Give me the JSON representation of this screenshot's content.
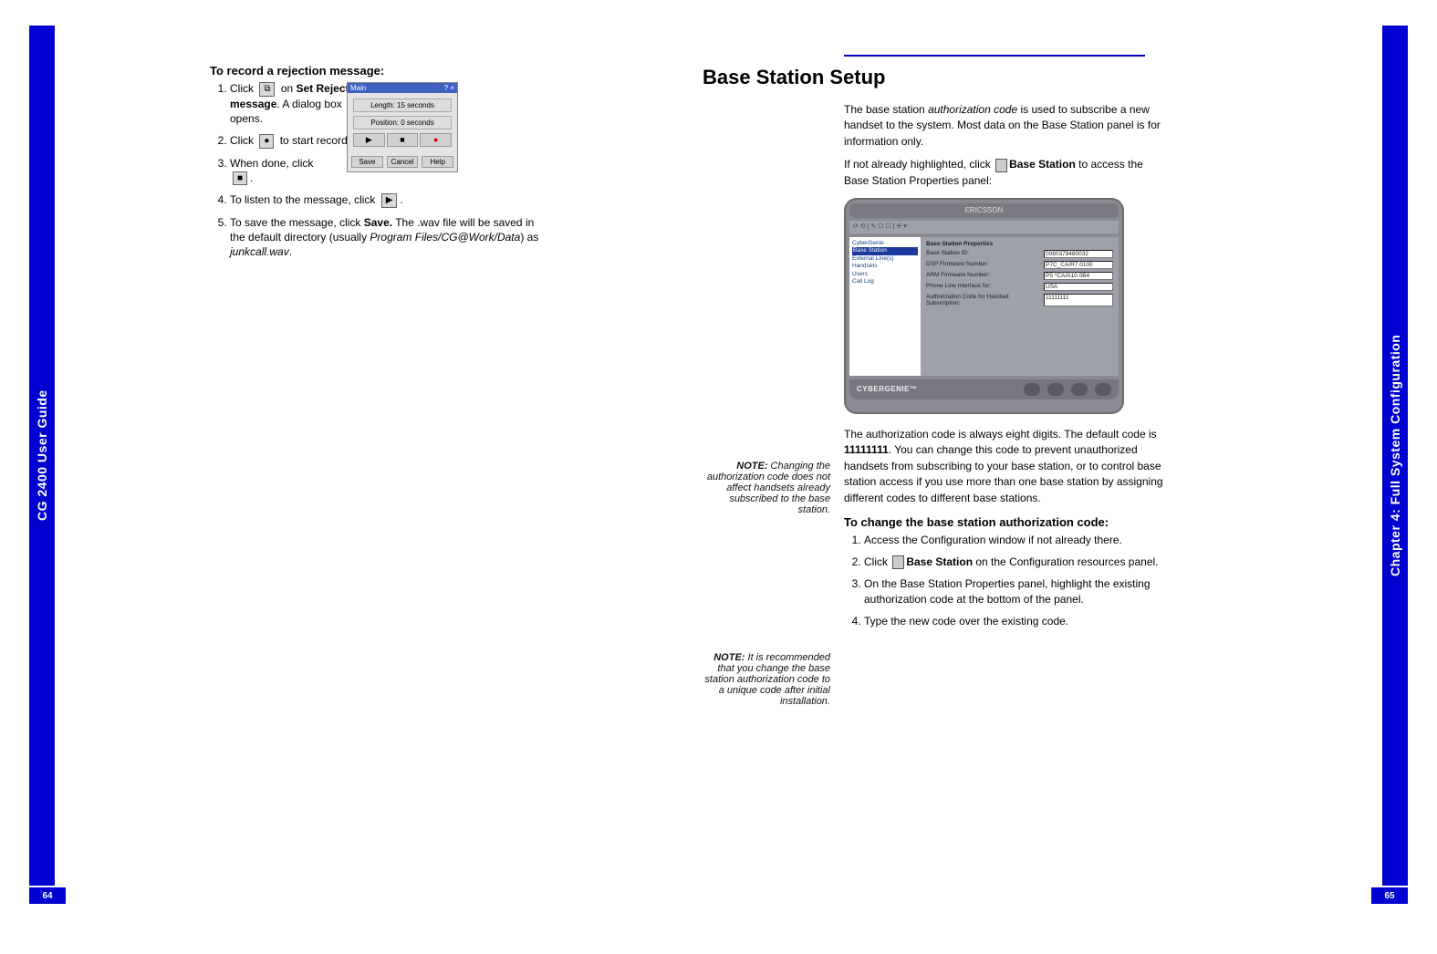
{
  "left_tab": "CG 2400 User Guide",
  "right_tab": "Chapter 4: Full System Configuration",
  "page_left_num": "64",
  "page_right_num": "65",
  "left": {
    "heading": "To record a rejection message:",
    "step1_a": "Click ",
    "step1_b": " on ",
    "step1_bold": "Set Rejection message",
    "step1_c": ". A dialog box opens.",
    "step2_a": "Click ",
    "step2_b": " to start recording.",
    "step3_a": "When done, click ",
    "step3_b": ".",
    "step4_a": "To listen to the message, click ",
    "step4_b": ".",
    "step5_a": "To save the message, click ",
    "step5_bold": "Save.",
    "step5_b": " The .wav file will be saved in the default directory (usually ",
    "step5_ital": "Program Files/CG@Work/Data",
    "step5_c": ") as ",
    "step5_ital2": "junkcall.wav",
    "step5_d": ".",
    "dialog": {
      "title": "Main",
      "len": "Length: 15 seconds",
      "pos": "Position: 0 seconds",
      "btn_play": "▶",
      "btn_stop": "■",
      "btn_rec": "●",
      "f_save": "Save",
      "f_cancel": "Cancel",
      "f_help": "Help"
    }
  },
  "right": {
    "title": "Base Station Setup",
    "p1_a": "The base station ",
    "p1_ital": "authorization code",
    "p1_b": " is used to subscribe a new handset to the system. Most data on the Base Station panel is for information only.",
    "p2_a": "If not already highlighted, click ",
    "p2_bold": "Base Station",
    "p2_b": " to access the Base Station Properties panel:",
    "panel": {
      "header": "ERICSSON",
      "tree": {
        "l1": "CyberGenie",
        "l2_sel": "Base Station",
        "l3": "External Line(s)",
        "l4": "Handsets",
        "l5": "Users",
        "l6": "Call Log"
      },
      "props_title": "Base Station Properties",
      "rows": [
        {
          "label": "Base Station ID:",
          "value": "0080379480032"
        },
        {
          "label": "DSP Firmware Number:",
          "value": "P7C_CA/R7.0100"
        },
        {
          "label": "ARM Firmware Number:",
          "value": "P5 *CA/A10.0B4"
        },
        {
          "label": "Phone Line Interface for:",
          "value": "USA"
        },
        {
          "label": "Authorization Code for Handset Subscription:",
          "value": "11111111"
        }
      ],
      "footer_logo": "CYBERGENIE™"
    },
    "note1_label": "NOTE:",
    "note1_body": " Changing the authorization code does not affect handsets already subscribed to the base station.",
    "p3_a": "The authorization code is always eight digits. The default code is ",
    "p3_bold": "11111111",
    "p3_b": ". You can change this code to prevent unauthorized handsets from subscribing to your base station, or to control base station access if you use more than one base station by assigning different codes to different base stations.",
    "sub_heading": "To change the base station authorization code:",
    "note2_label": "NOTE:",
    "note2_body": " It is recommended that you change the base station authorization code to a unique code after initial installation.",
    "s1": "Access the Configuration window if not already there.",
    "s2_a": "Click ",
    "s2_bold": "Base Station",
    "s2_b": " on the Configuration resources panel.",
    "s3": "On the Base Station Properties panel, highlight the existing authorization code at the bottom of the panel.",
    "s4": "Type the new code over the existing code."
  }
}
